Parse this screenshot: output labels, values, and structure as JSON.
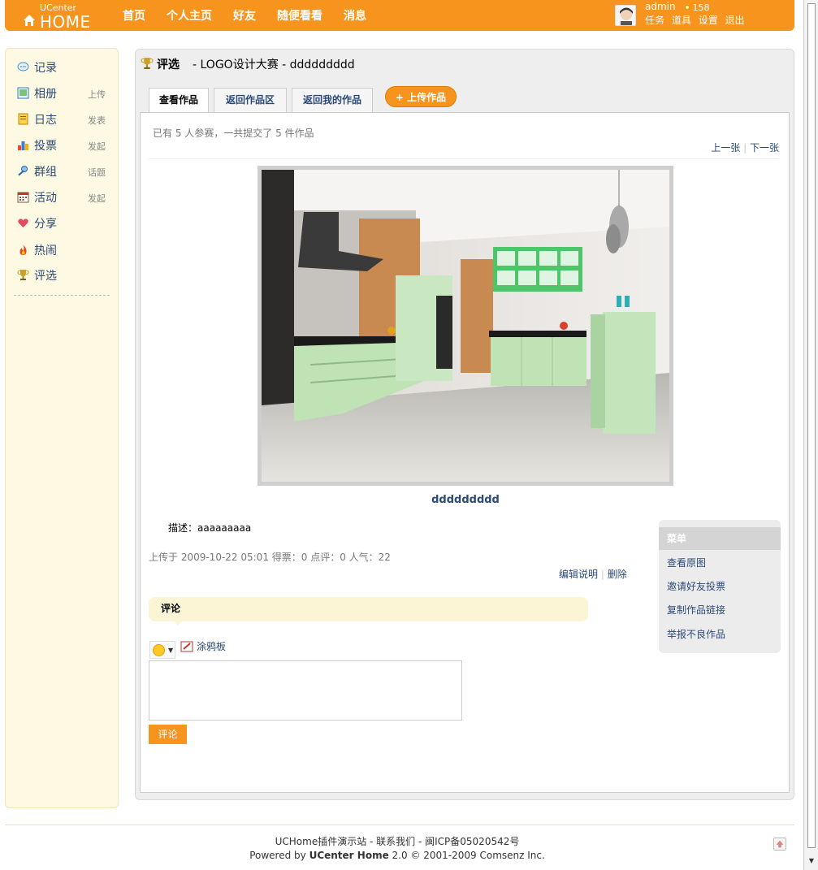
{
  "header": {
    "logo_top": "UCenter",
    "logo_main": "HOME",
    "nav": [
      "首页",
      "个人主页",
      "好友",
      "随便看看",
      "消息"
    ],
    "username": "admin",
    "credit": "158",
    "user_links": [
      "任务",
      "道具",
      "设置",
      "退出"
    ]
  },
  "sidebar": {
    "items": [
      {
        "label": "记录",
        "action": "",
        "icon": "speech-bubble-icon"
      },
      {
        "label": "相册",
        "action": "上传",
        "icon": "photo-album-icon"
      },
      {
        "label": "日志",
        "action": "发表",
        "icon": "journal-icon"
      },
      {
        "label": "投票",
        "action": "发起",
        "icon": "bar-chart-icon"
      },
      {
        "label": "群组",
        "action": "话题",
        "icon": "group-icon"
      },
      {
        "label": "活动",
        "action": "发起",
        "icon": "calendar-icon"
      },
      {
        "label": "分享",
        "action": "",
        "icon": "heart-share-icon"
      },
      {
        "label": "热闹",
        "action": "",
        "icon": "fire-icon"
      },
      {
        "label": "评选",
        "action": "",
        "icon": "trophy-icon"
      }
    ]
  },
  "page": {
    "title": "评选",
    "subtitle": "- LOGO设计大赛 - ddddddddd",
    "tabs": [
      "查看作品",
      "返回作品区",
      "返回我的作品"
    ],
    "upload_button": "+ 上传作品",
    "summary": "已有 5 人参赛，一共提交了 5 件作品",
    "prev": "上一张",
    "next": "下一张",
    "photo_title": "ddddddddd",
    "description_label": "描述：",
    "description": "aaaaaaaaa",
    "meta": "上传于 2009-10-22 05:01    得票：0   点评：0   人气：22",
    "edit_link": "编辑说明",
    "delete_link": "删除",
    "comment_header": "评论",
    "doodle_label": "涂鸦板",
    "comment_button": "评论"
  },
  "menu": {
    "header": "菜单",
    "items": [
      "查看原图",
      "邀请好友投票",
      "复制作品链接",
      "举报不良作品"
    ]
  },
  "footer": {
    "line1": "UCHome插件演示站 - 联系我们 - 闽ICP备05020542号",
    "line2_prefix": "Powered by ",
    "line2_brand": "UCenter Home",
    "line2_suffix": " 2.0 © 2001-2009 Comsenz Inc."
  },
  "colors": {
    "accent": "#f7941d",
    "link": "#2b4a78",
    "sidebar_bg": "#fdf9e3"
  }
}
